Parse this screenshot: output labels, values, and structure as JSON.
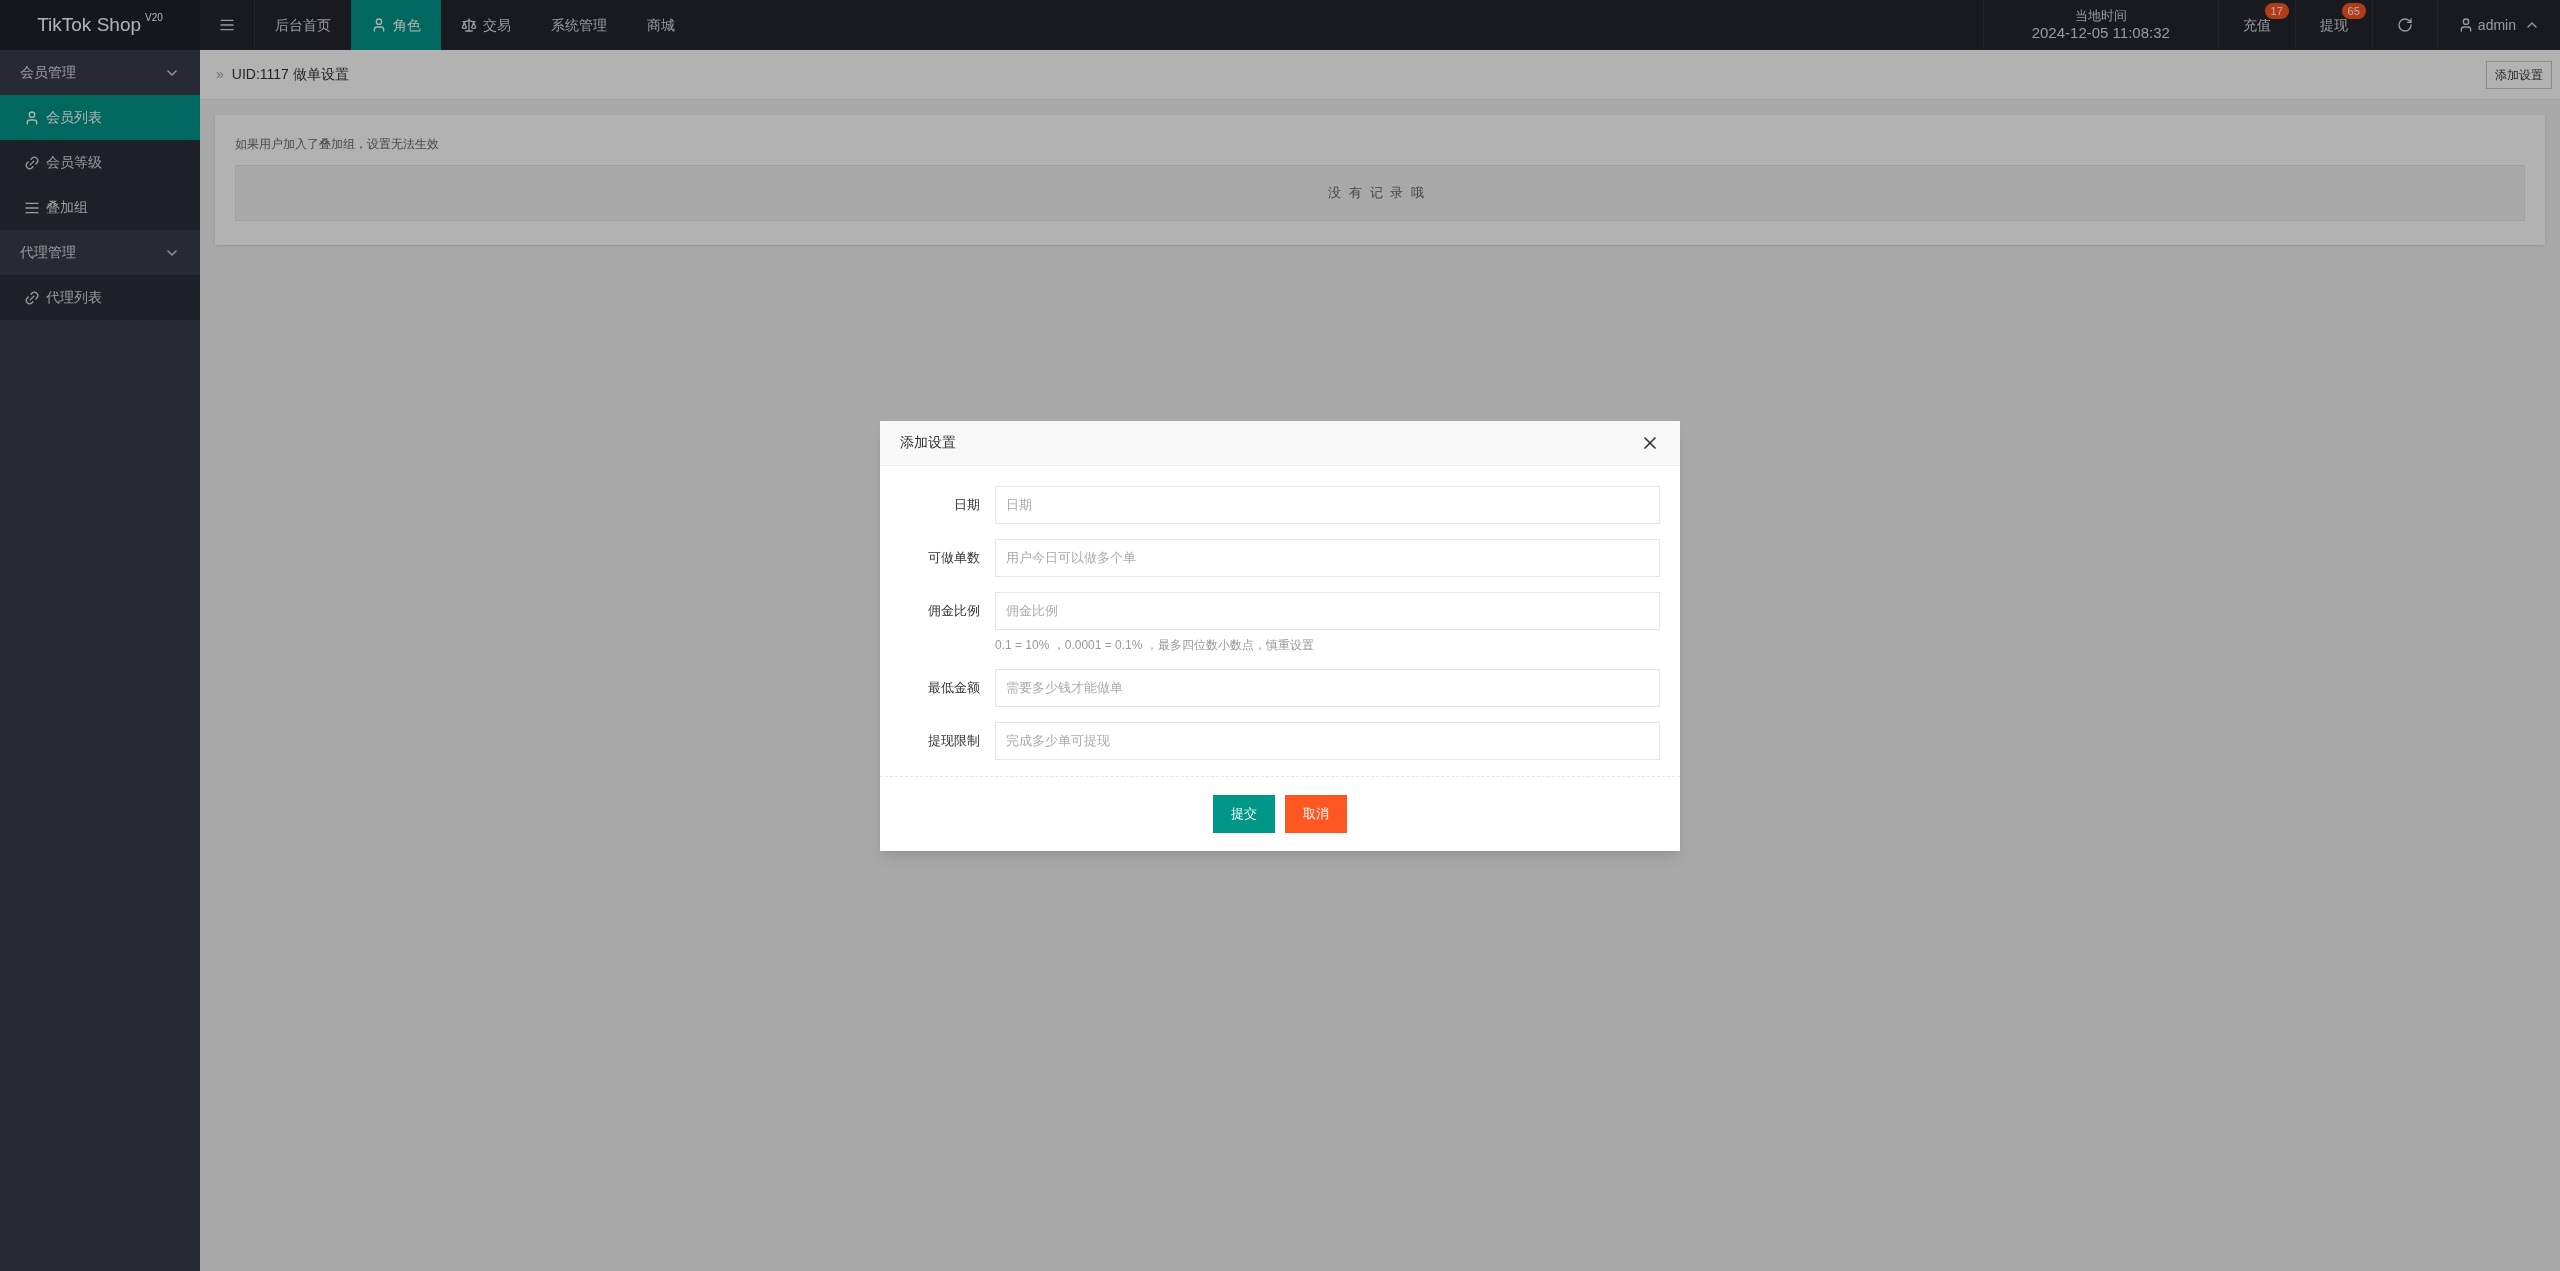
{
  "header": {
    "logo": "TikTok Shop",
    "logo_version": "V20",
    "nav": [
      {
        "label": "后台首页",
        "kind": "plain",
        "selected": false
      },
      {
        "label": "角色",
        "kind": "person",
        "selected": true
      },
      {
        "label": "交易",
        "kind": "balance",
        "selected": false
      },
      {
        "label": "系统管理",
        "kind": "plain",
        "selected": false
      },
      {
        "label": "商城",
        "kind": "plain",
        "selected": false
      }
    ],
    "clock_label": "当地时间",
    "clock": "2024-12-05 11:08:32",
    "actions": [
      {
        "label": "充值",
        "badge": "17"
      },
      {
        "label": "提现",
        "badge": "65"
      }
    ],
    "user": "admin"
  },
  "sidebar": {
    "groups": [
      {
        "label": "会员管理",
        "expanded": true,
        "children": [
          {
            "label": "会员列表",
            "kind": "person",
            "selected": true
          },
          {
            "label": "会员等级",
            "kind": "chain",
            "selected": false
          },
          {
            "label": "叠加组",
            "kind": "lines",
            "selected": false
          }
        ]
      },
      {
        "label": "代理管理",
        "expanded": true,
        "children": [
          {
            "label": "代理列表",
            "kind": "chain",
            "selected": false
          }
        ]
      }
    ]
  },
  "breadcrumb": {
    "separator": "»",
    "title": "UID:1117 做单设置"
  },
  "add_button": "添加设置",
  "notice": "如果用户加入了叠加组，设置无法生效",
  "empty_text": "没有记录哦",
  "dialog": {
    "title": "添加设置",
    "fields": [
      {
        "label": "日期",
        "placeholder": "日期"
      },
      {
        "label": "可做单数",
        "placeholder": "用户今日可以做多个单"
      },
      {
        "label": "佣金比例",
        "placeholder": "佣金比例",
        "hint": "0.1 = 10% ，0.0001 = 0.1% ，最多四位数小数点，慎重设置"
      },
      {
        "label": "最低金额",
        "placeholder": "需要多少钱才能做单"
      },
      {
        "label": "提现限制",
        "placeholder": "完成多少单可提现"
      }
    ],
    "buttons": [
      {
        "label": "提交",
        "kind": "primary"
      },
      {
        "label": "取消",
        "kind": "danger"
      }
    ]
  }
}
